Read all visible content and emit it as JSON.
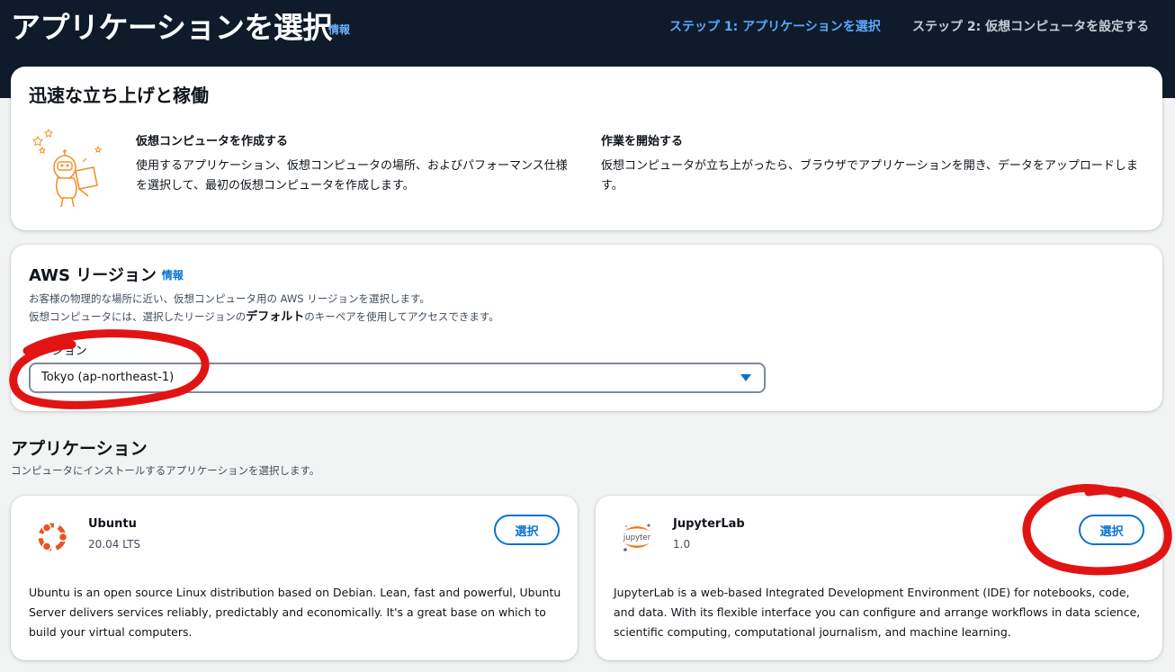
{
  "header": {
    "title": "アプリケーションを選択",
    "info": "情報",
    "steps": [
      {
        "label": "ステップ 1: アプリケーションを選択",
        "active": true
      },
      {
        "label": "ステップ 2: 仮想コンピュータを設定する",
        "active": false
      }
    ]
  },
  "getting_started": {
    "title": "迅速な立ち上げと稼働",
    "illustration_icon": "robot-laptop-illustration",
    "columns": [
      {
        "heading": "仮想コンピュータを作成する",
        "text": "使用するアプリケーション、仮想コンピュータの場所、およびパフォーマンス仕様を選択して、最初の仮想コンピュータを作成します。"
      },
      {
        "heading": "作業を開始する",
        "text": "仮想コンピュータが立ち上がったら、ブラウザでアプリケーションを開き、データをアップロードします。"
      }
    ]
  },
  "region": {
    "title": "AWS リージョン",
    "info": "情報",
    "desc_line1": "お客様の物理的な場所に近い、仮想コンピュータ用の AWS リージョンを選択します。",
    "desc_line2_pre": "仮想コンピュータには、選択したリージョンの",
    "desc_line2_bold": "デフォルト",
    "desc_line2_post": "のキーペアを使用してアクセスできます。",
    "label": "リージョン",
    "selected": "Tokyo (ap-northeast-1)"
  },
  "applications": {
    "title": "アプリケーション",
    "desc": "コンピュータにインストールするアプリケーションを選択します。",
    "items": [
      {
        "name": "Ubuntu",
        "version": "20.04 LTS",
        "icon": "ubuntu-logo-icon",
        "button": "選択",
        "description": "Ubuntu is an open source Linux distribution based on Debian. Lean, fast and powerful, Ubuntu Server delivers services reliably, predictably and economically. It's a great base on which to build your virtual computers."
      },
      {
        "name": "JupyterLab",
        "version": "1.0",
        "icon": "jupyter-logo-icon",
        "logo_text": "jupyter",
        "button": "選択",
        "description": "JupyterLab is a web-based Integrated Development Environment (IDE) for notebooks, code, and data. With its flexible interface you can configure and arrange workflows in data science, scientific computing, computational journalism, and machine learning."
      }
    ]
  },
  "colors": {
    "header_bg": "#0f1b2a",
    "link": "#0972d3",
    "annotation": "#e11414",
    "ubuntu_orange": "#e95420",
    "jupyter_orange": "#f37726"
  }
}
